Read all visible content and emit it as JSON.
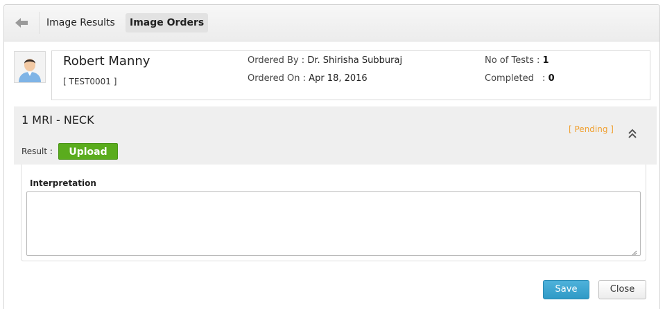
{
  "header": {
    "back_icon": "arrow-left-icon",
    "tabs": [
      {
        "label": "Image Results",
        "active": false
      },
      {
        "label": "Image Orders",
        "active": true
      }
    ]
  },
  "patient": {
    "avatar_icon": "user-avatar-icon",
    "name": "Robert Manny",
    "id": "[ TEST0001 ]",
    "ordered_by_label": "Ordered By :",
    "ordered_by": "Dr. Shirisha Subburaj",
    "ordered_on_label": "Ordered On :",
    "ordered_on": "Apr 18, 2016",
    "tests_label": "No of Tests :",
    "tests": "1",
    "completed_label": "Completed",
    "completed_sep": ":",
    "completed": "0"
  },
  "order": {
    "title": "1 MRI - NECK",
    "status": "[ Pending ]",
    "status_color": "#f0a030",
    "collapse_icon": "chevron-double-up-icon",
    "result_label": "Result :",
    "upload_label": "Upload",
    "upload_color": "#5aac1d",
    "interpretation_label": "Interpretation",
    "interpretation_value": ""
  },
  "footer": {
    "save_label": "Save",
    "save_color": "#3aa4cf",
    "close_label": "Close"
  }
}
